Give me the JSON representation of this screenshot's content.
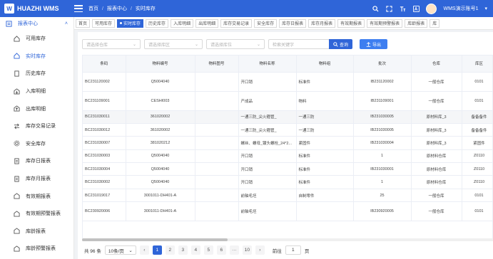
{
  "app": {
    "logo_mark": "W",
    "title": "HUAZHI WMS"
  },
  "breadcrumb": [
    "首页",
    "报表中心",
    "实时库存"
  ],
  "topbar": {
    "user_label": "WMS演示账号1"
  },
  "sidebar": {
    "header": "报表中心",
    "items": [
      {
        "label": "可用库存"
      },
      {
        "label": "实时库存"
      },
      {
        "label": "历史库存"
      },
      {
        "label": "入库明细"
      },
      {
        "label": "出库明细"
      },
      {
        "label": "库存交易记录"
      },
      {
        "label": "安全库存"
      },
      {
        "label": "库存日报表"
      },
      {
        "label": "库存月报表"
      },
      {
        "label": "有效期报表"
      },
      {
        "label": "有效期预警报表"
      },
      {
        "label": "库龄报表"
      },
      {
        "label": "库龄预警报表"
      }
    ]
  },
  "tabs": [
    "首页",
    "可用库存",
    "实时库存",
    "历史库存",
    "入库明细",
    "出库明细",
    "库存交易记录",
    "安全库存",
    "库存日报表",
    "库存月报表",
    "有效期报表",
    "有效期预警报表",
    "库龄报表",
    "库"
  ],
  "filters": {
    "warehouse_placeholder": "请选择仓库",
    "area_placeholder": "请选择库区",
    "location_placeholder": "请选择库位",
    "keyword_placeholder": "检索关键字",
    "search_label": "查询",
    "export_label": "导出"
  },
  "table": {
    "columns": [
      "条码",
      "物料编号",
      "物料图号",
      "物料名称",
      "物料组",
      "批次",
      "仓库",
      "库区"
    ],
    "rows": [
      [
        "BC231120002",
        "Q5004040",
        "",
        "开口销",
        "标准件",
        "IB231120002",
        "一般仓库",
        "0101"
      ],
      [
        "BC231109001",
        "CESHI003",
        "",
        "产成品",
        "物料",
        "IB231109001",
        "一般仓库",
        "0101"
      ],
      [
        "BC231030011",
        "361020002",
        "",
        "一通三防_尖火箍管_",
        "一通三防",
        "IB231030005",
        "原材料库_3",
        "备备备件"
      ],
      [
        "BC231030012",
        "361020002",
        "",
        "一通三防_尖火箍管_",
        "一通三防",
        "IB231030005",
        "原材料库_3",
        "备备备件"
      ],
      [
        "BC231030007",
        "381020212",
        "",
        "螺丝、螺母_镀头螺栓_24*2...",
        "紧固件",
        "IB231030004",
        "原材料库_3",
        "紧固件"
      ],
      [
        "BC231030003",
        "Q5004040",
        "",
        "开口销",
        "标准件",
        "1",
        "原材料仓库",
        "Z0110"
      ],
      [
        "BC231030004",
        "Q5004040",
        "",
        "开口销",
        "标准件",
        "IB231030001",
        "原材料仓库",
        "Z0110"
      ],
      [
        "BC231030002",
        "Q5004040",
        "",
        "开口销",
        "标准件",
        "1",
        "原材料仓库",
        "Z0110"
      ],
      [
        "BC231019017",
        "3001011-DH401-A",
        "",
        "前轴毛坯",
        "自制零件",
        "25",
        "一般仓库",
        "0101"
      ],
      [
        "BC230920006",
        "3001011-DH401-A",
        "",
        "前轴毛坯",
        "",
        "IB230920005",
        "一般仓库",
        "0101"
      ]
    ]
  },
  "pagination": {
    "total": "共 96 条",
    "page_size": "10条/页",
    "pages": [
      "1",
      "2",
      "3",
      "4",
      "5",
      "6",
      "···",
      "10"
    ],
    "goto_label": "前往",
    "goto_value": "1",
    "page_unit": "页"
  },
  "colors": {
    "primary": "#2f65d8"
  }
}
